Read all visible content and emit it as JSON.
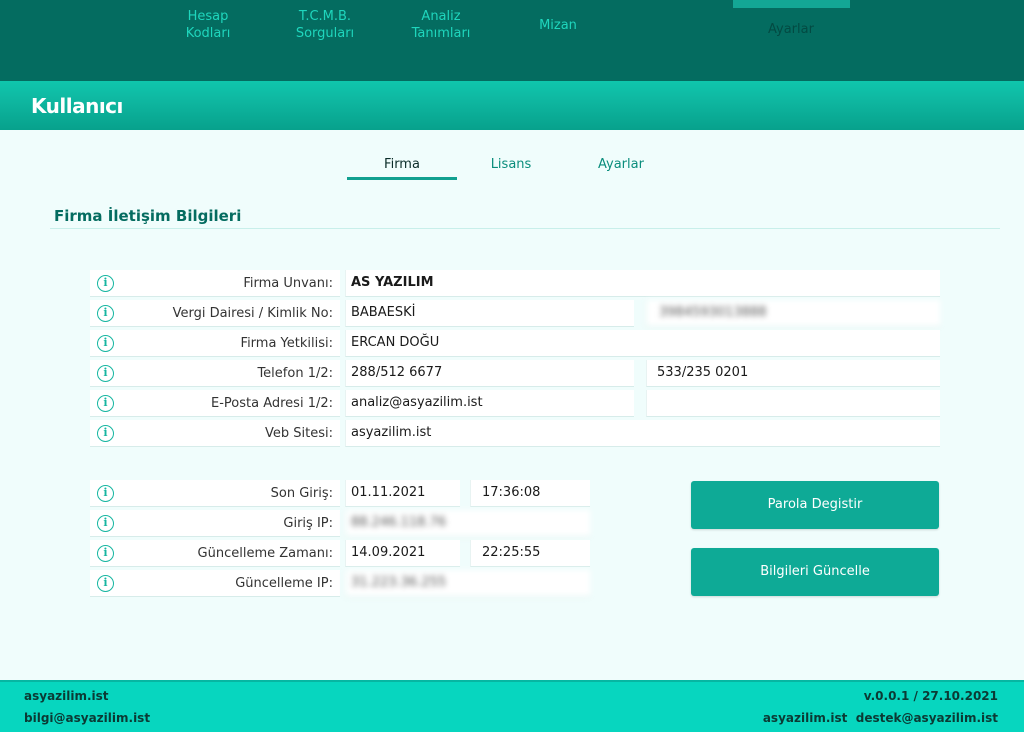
{
  "nav": {
    "items": [
      {
        "line1": "Hesap",
        "line2": "Kodları"
      },
      {
        "line1": "T.C.M.B.",
        "line2": "Sorguları"
      },
      {
        "line1": "Analiz",
        "line2": "Tanımları"
      },
      {
        "line1": "Mizan",
        "line2": ""
      }
    ],
    "active": "Ayarlar"
  },
  "page_title": "Kullanıcı",
  "tabs": [
    "Firma",
    "Lisans",
    "Ayarlar"
  ],
  "section_title": "Firma İletişim Bilgileri",
  "firm_rows": [
    {
      "label": "Firma Unvanı:",
      "value1": "AS YAZILIM",
      "value2": null
    },
    {
      "label": "Vergi Dairesi / Kimlik No:",
      "value1": "BABAESKİ",
      "value2": "3984593013888"
    },
    {
      "label": "Firma Yetkilisi:",
      "value1": "ERCAN DOĞU",
      "value2": null
    },
    {
      "label": "Telefon 1/2:",
      "value1": "288/512 6677",
      "value2": "533/235 0201"
    },
    {
      "label": "E-Posta Adresi 1/2:",
      "value1": "analiz@asyazilim.ist",
      "value2": ""
    },
    {
      "label": "Veb Sitesi:",
      "value1": "asyazilim.ist",
      "value2": null
    }
  ],
  "login_rows": [
    {
      "label": "Son Giriş:",
      "value1": "01.11.2021",
      "value2": "17:36:08"
    },
    {
      "label": "Giriş IP:",
      "value1": "88.246.118.76",
      "value2": null
    },
    {
      "label": "Güncelleme Zamanı:",
      "value1": "14.09.2021",
      "value2": "22:25:55"
    },
    {
      "label": "Güncelleme IP:",
      "value1": "31.223.36.255",
      "value2": null
    }
  ],
  "buttons": {
    "change_password": "Parola Degistir",
    "update_info": "Bilgileri Güncelle"
  },
  "footer": {
    "left_site": "asyazilim.ist",
    "left_email": "bilgi@asyazilim.ist",
    "version": "v.0.0.1 / 27.10.2021",
    "right_site": "asyazilim.ist",
    "right_email": "destek@asyazilim.ist"
  },
  "colors": {
    "nav_bg": "#046c60",
    "accent": "#0eaa96",
    "footer_bg": "#07d6bf",
    "page_bg": "#f0fdfc"
  }
}
